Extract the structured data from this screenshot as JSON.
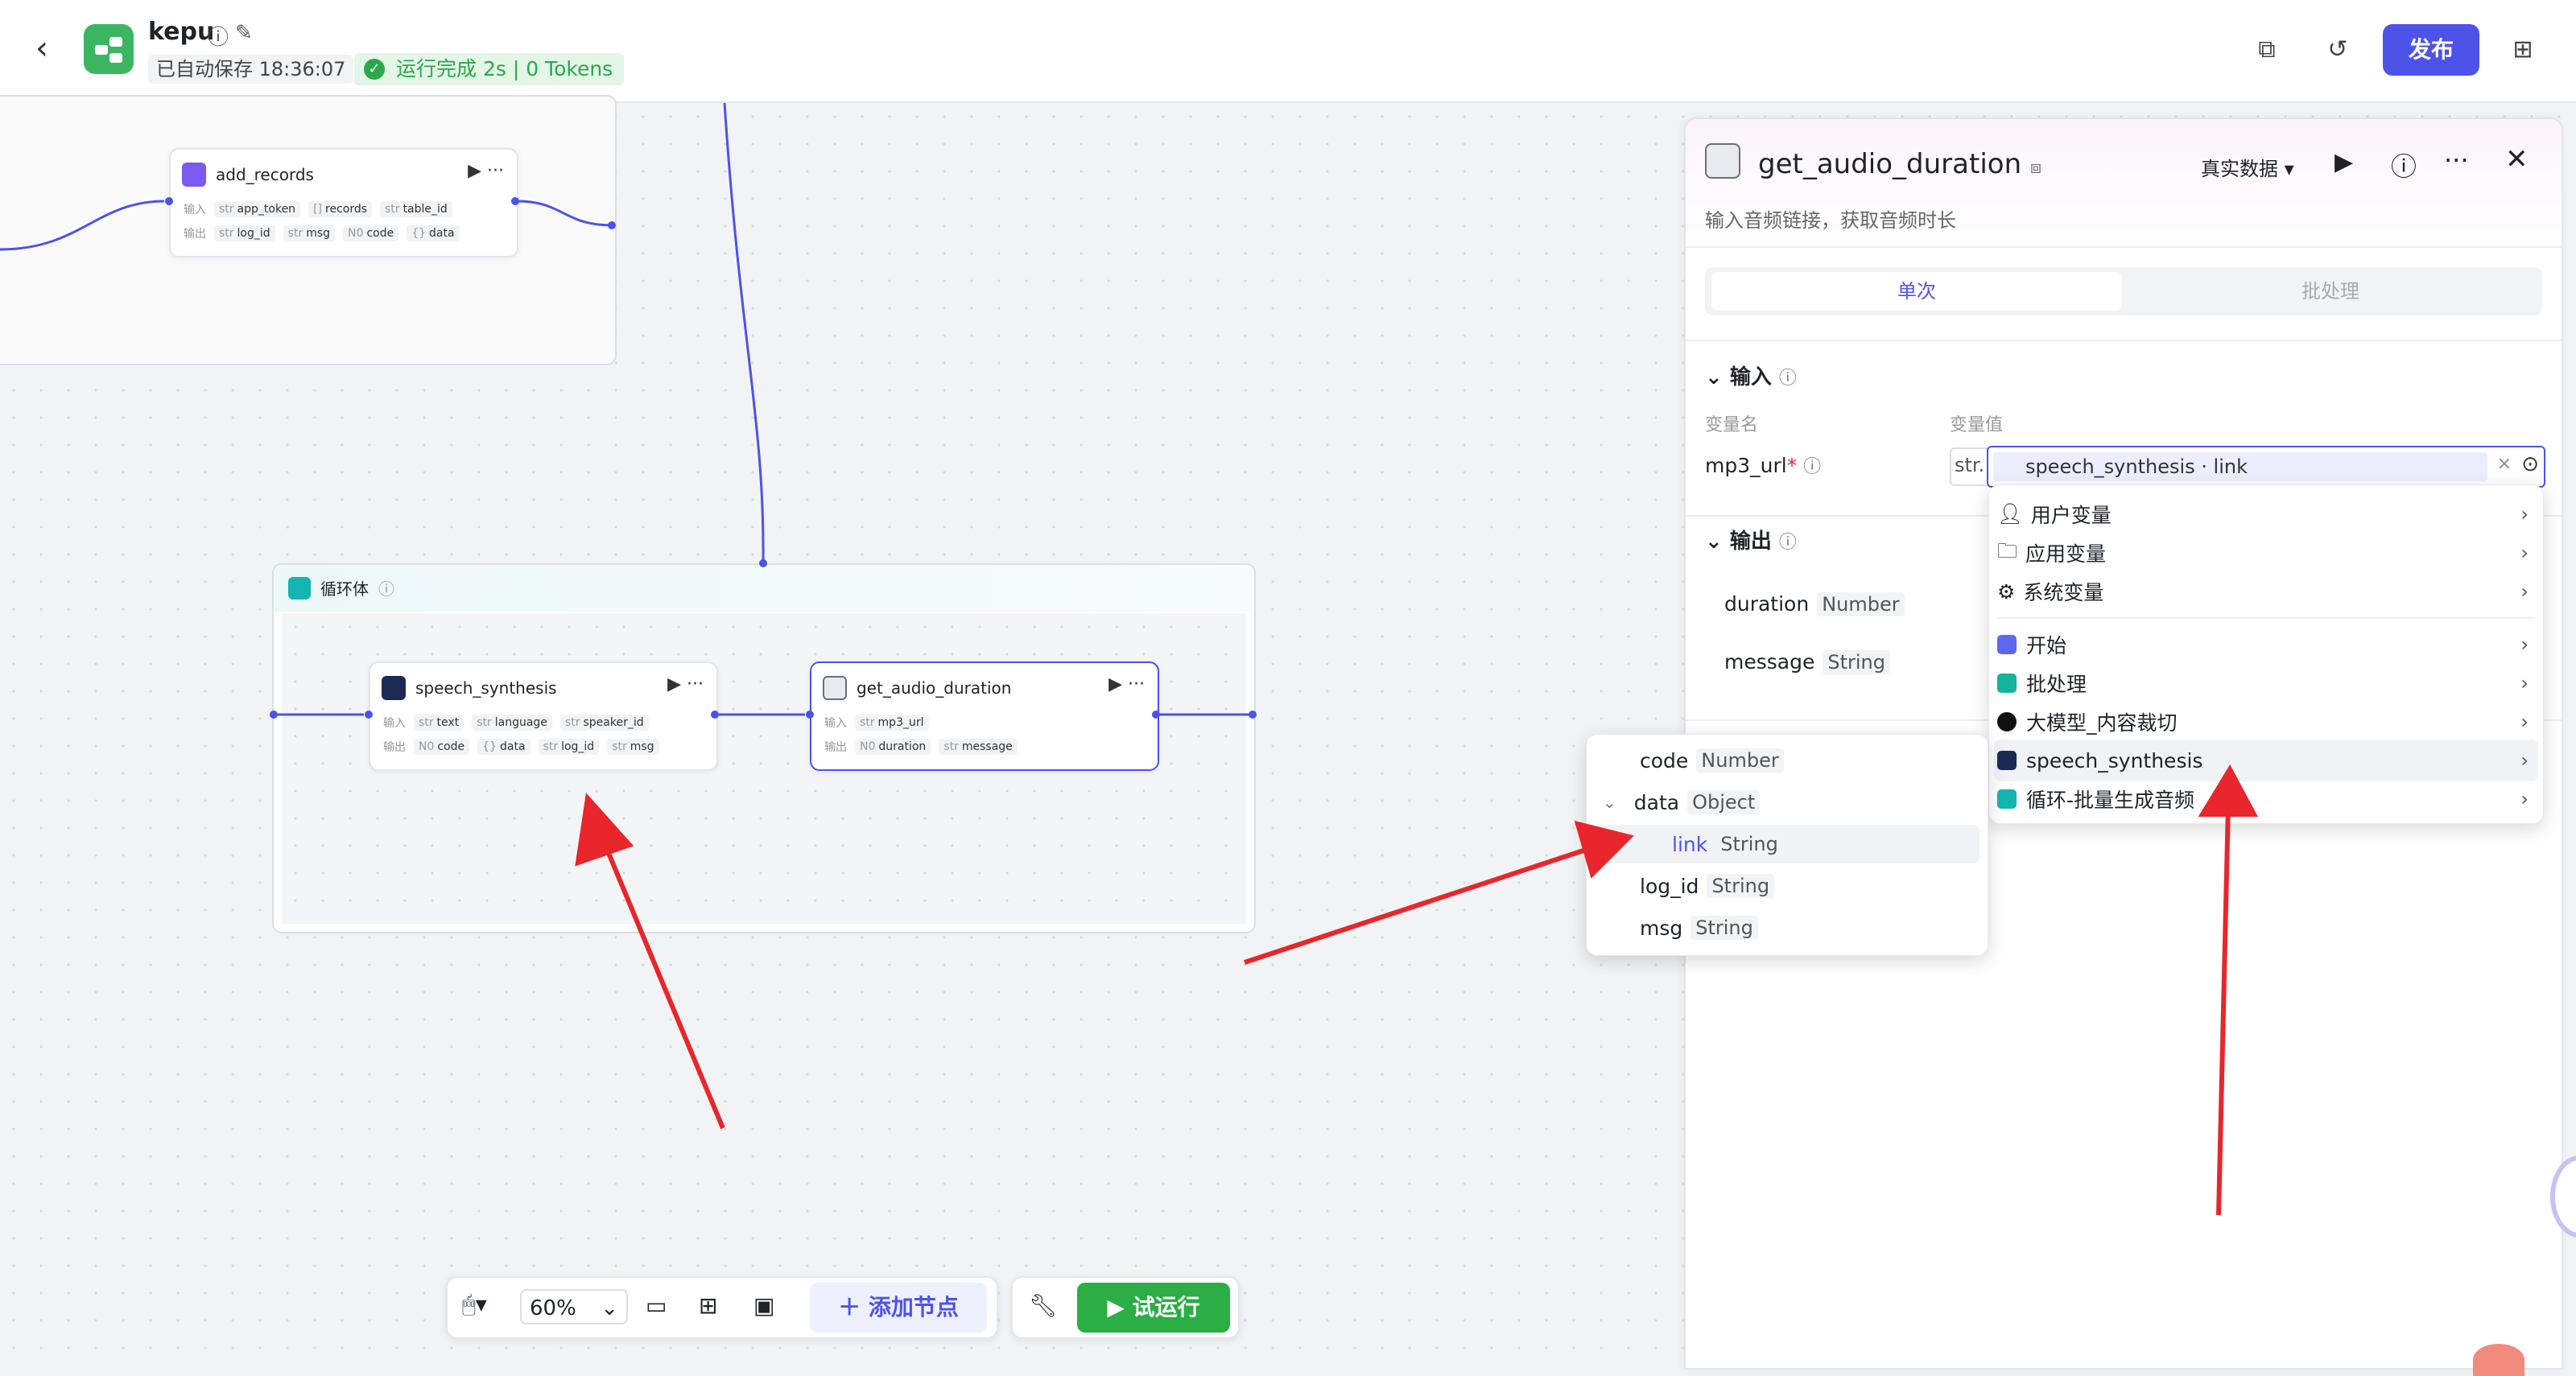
{
  "header": {
    "app_name": "kepu",
    "saved_text": "已自动保存 18:36:07",
    "run_status": "运行完成 2s | 0 Tokens",
    "publish_label": "发布"
  },
  "canvas": {
    "nodes": {
      "add_records": {
        "title": "add_records",
        "input_label": "输入",
        "output_label": "输出",
        "inputs": [
          {
            "type": "str",
            "name": "app_token"
          },
          {
            "type": "[]",
            "name": "records"
          },
          {
            "type": "str",
            "name": "table_id"
          }
        ],
        "outputs": [
          {
            "type": "str",
            "name": "log_id"
          },
          {
            "type": "str",
            "name": "msg"
          },
          {
            "type": "N0",
            "name": "code"
          },
          {
            "type": "{}",
            "name": "data"
          }
        ]
      },
      "loop": {
        "title": "循环体"
      },
      "speech_synthesis": {
        "title": "speech_synthesis",
        "input_label": "输入",
        "output_label": "输出",
        "inputs": [
          {
            "type": "str",
            "name": "text"
          },
          {
            "type": "str",
            "name": "language"
          },
          {
            "type": "str",
            "name": "speaker_id"
          }
        ],
        "outputs": [
          {
            "type": "N0",
            "name": "code"
          },
          {
            "type": "{}",
            "name": "data"
          },
          {
            "type": "str",
            "name": "log_id"
          },
          {
            "type": "str",
            "name": "msg"
          }
        ]
      },
      "get_audio_duration": {
        "title": "get_audio_duration",
        "input_label": "输入",
        "output_label": "输出",
        "inputs": [
          {
            "type": "str",
            "name": "mp3_url"
          }
        ],
        "outputs": [
          {
            "type": "N0",
            "name": "duration"
          },
          {
            "type": "str",
            "name": "message"
          }
        ]
      }
    }
  },
  "toolbar": {
    "zoom": "60%",
    "add_node_label": "添加节点",
    "try_run_label": "试运行"
  },
  "panel": {
    "title": "get_audio_duration",
    "data_mode": "真实数据",
    "description": "输入音频链接，获取音频时长",
    "tab_single": "单次",
    "tab_batch": "批处理",
    "input_section": "输入",
    "col_name": "变量名",
    "col_value": "变量值",
    "param_name": "mp3_url",
    "param_type": "str.",
    "param_ref": "speech_synthesis · link",
    "output_section": "输出",
    "outputs": [
      {
        "name": "duration",
        "type": "Number"
      },
      {
        "name": "message",
        "type": "String"
      }
    ]
  },
  "var_menu": {
    "items": [
      "用户变量",
      "应用变量",
      "系统变量",
      "开始",
      "批处理",
      "大模型_内容裁切",
      "speech_synthesis",
      "循环-批量生成音频"
    ]
  },
  "sub_menu": {
    "items": [
      {
        "name": "code",
        "type": "Number"
      },
      {
        "name": "data",
        "type": "Object"
      },
      {
        "name": "link",
        "type": "String"
      },
      {
        "name": "log_id",
        "type": "String"
      },
      {
        "name": "msg",
        "type": "String"
      }
    ]
  },
  "colors": {
    "accent": "#4d53e8",
    "success": "#2aae45",
    "arrow": "#e8262b"
  }
}
